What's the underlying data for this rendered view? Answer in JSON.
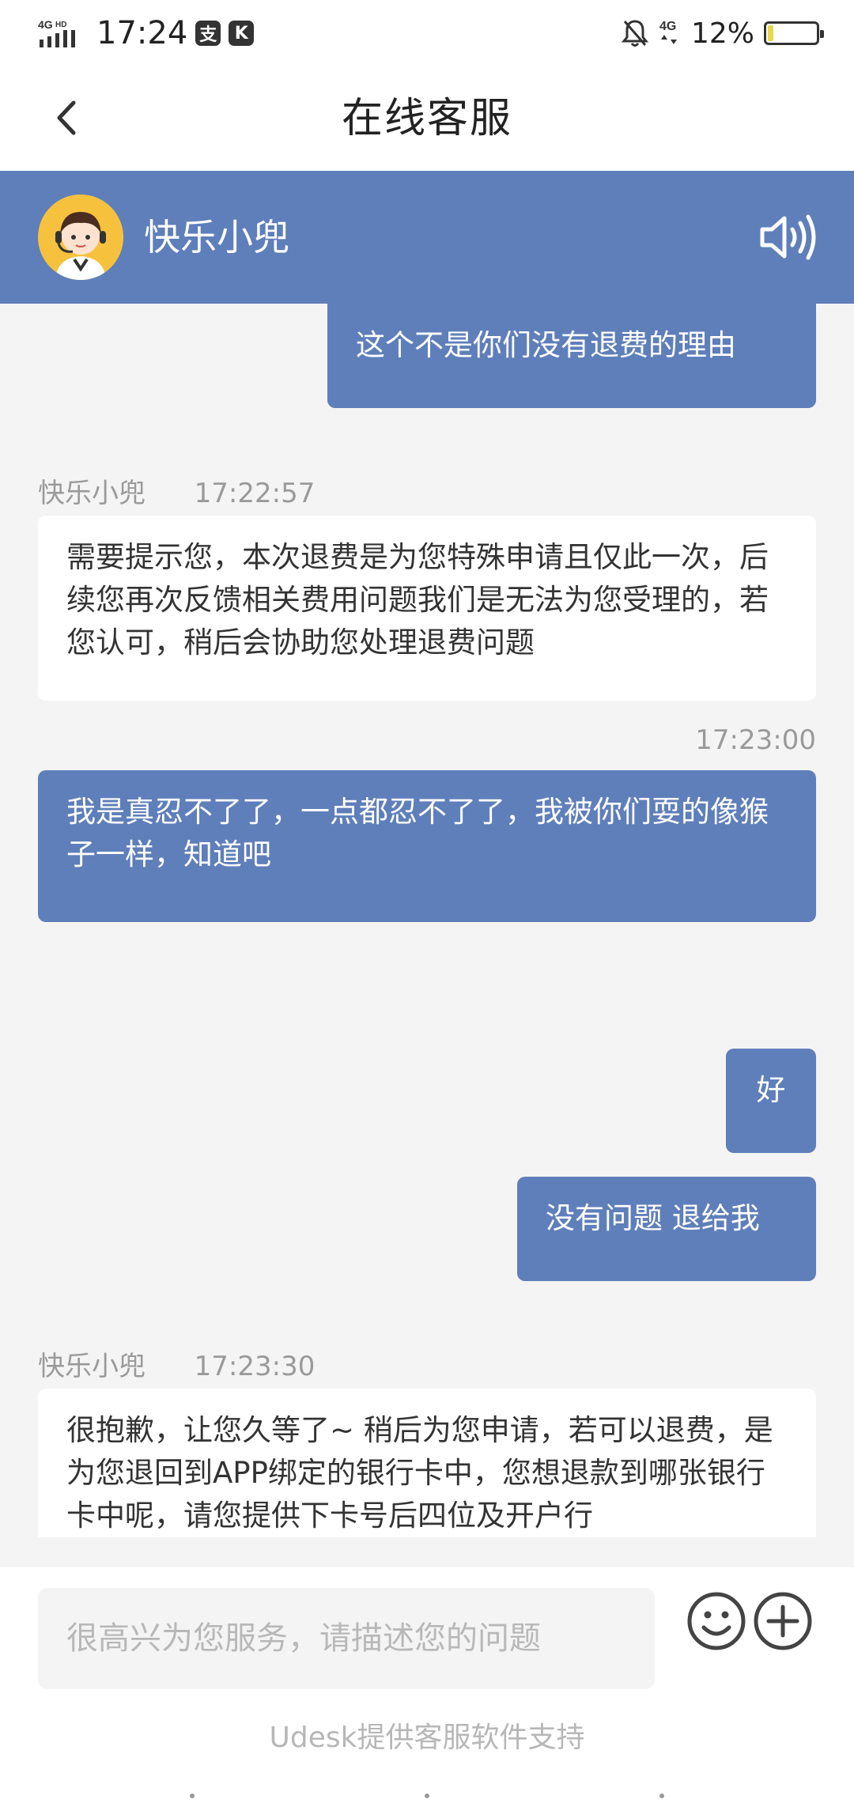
{
  "status_bar": {
    "network": "4G HD",
    "time": "17:24",
    "badges": [
      "支",
      "K"
    ],
    "signal_right": "4G",
    "battery_percent": "12%",
    "battery_level": 0.12,
    "icons": [
      "signal-icon",
      "alarm-off-icon",
      "battery-icon"
    ]
  },
  "header": {
    "title": "在线客服",
    "back_icon": "chevron-left-icon"
  },
  "agent": {
    "name": "快乐小兜",
    "speaker_icon": "speaker-icon",
    "avatar_icon": "agent-avatar",
    "accent_color": "#5f7fba"
  },
  "messages": [
    {
      "from": "user",
      "text": "这个不是你们没有退费的理由"
    },
    {
      "from": "agent",
      "sender": "快乐小兜",
      "time": "17:22:57",
      "text": "需要提示您，本次退费是为您特殊申请且仅此一次，后续您再次反馈相关费用问题我们是无法为您受理的，若您认可，稍后会协助您处理退费问题"
    },
    {
      "from": "user",
      "time": "17:23:00",
      "text": "我是真忍不了了，一点都忍不了了，我被你们耍的像猴子一样，知道吧"
    },
    {
      "from": "user",
      "text": "好"
    },
    {
      "from": "user",
      "text": "没有问题 退给我"
    },
    {
      "from": "agent",
      "sender": "快乐小兜",
      "time": "17:23:30",
      "text": "很抱歉，让您久等了~ 稍后为您申请，若可以退费，是为您退回到APP绑定的银行卡中，您想退款到哪张银行卡中呢，请您提供下卡号后四位及开户行"
    }
  ],
  "input": {
    "placeholder": "很高兴为您服务，请描述您的问题",
    "value": "",
    "emoji_icon": "smiley-icon",
    "plus_icon": "plus-circle-icon"
  },
  "footer": {
    "support_text": "Udesk提供客服软件支持"
  }
}
